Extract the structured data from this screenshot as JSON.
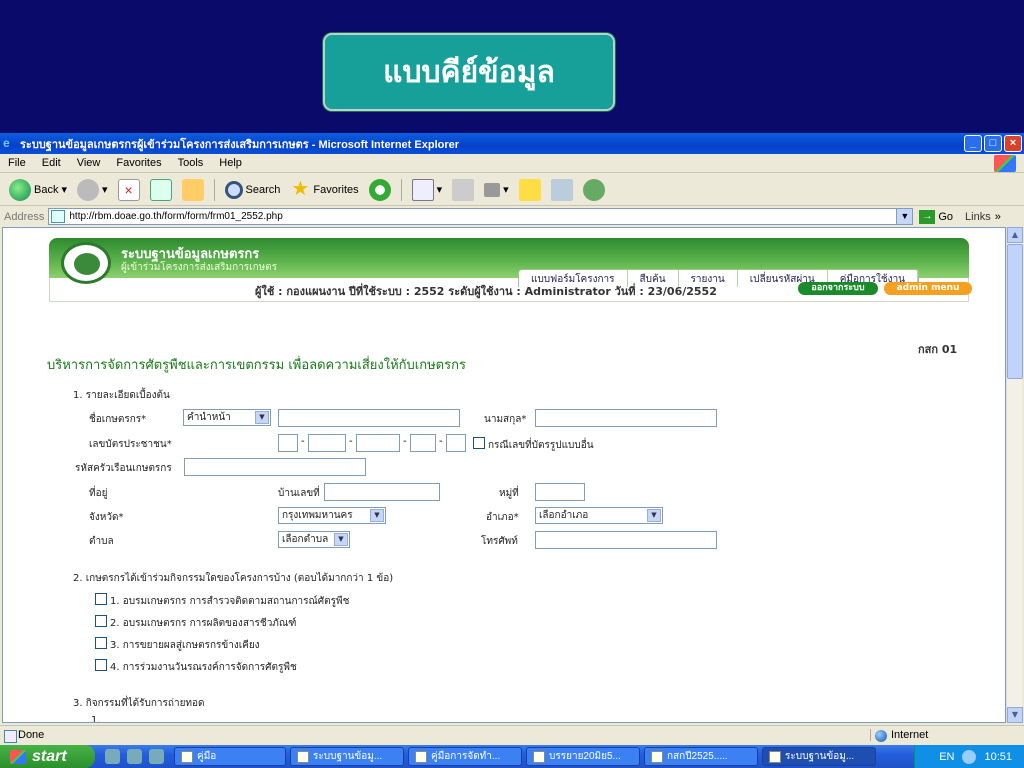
{
  "slide": {
    "banner_text": "แบบคีย์ข้อมูล"
  },
  "browser": {
    "title": "ระบบฐานข้อมูลเกษตรกรผู้เข้าร่วมโครงการส่งเสริมการเกษตร - Microsoft Internet Explorer",
    "menu": [
      "File",
      "Edit",
      "View",
      "Favorites",
      "Tools",
      "Help"
    ],
    "toolbar": {
      "back": "Back",
      "search": "Search",
      "favorites": "Favorites"
    },
    "address_label": "Address",
    "address": "http://rbm.doae.go.th/form/form/frm01_2552.php",
    "go": "Go",
    "links": "Links",
    "status": "Done",
    "zone": "Internet"
  },
  "site": {
    "title": "ระบบฐานข้อมูลเกษตรกร",
    "subtitle": "ผู้เข้าร่วมโครงการส่งเสริมการเกษตร",
    "nav": [
      "แบบฟอร์มโครงการ",
      "สืบค้น",
      "รายงาน",
      "เปลี่ยนรหัสผ่าน",
      "คู่มือการใช้งาน"
    ],
    "userline": "ผู้ใช้ : กองแผนงาน   ปีที่ใช้ระบบ : 2552   ระดับผู้ใช้งาน : Administrator   วันที่ : 23/06/2552",
    "logout": "ออกจากระบบ",
    "admin_menu": "admin menu"
  },
  "form": {
    "code": "กสก 01",
    "title": "บริหารการจัดการศัตรูพืชและการเขตกรรม เพื่อลดความเสี่ยงให้กับเกษตรกร",
    "section1": "1. รายละเอียดเบื้องต้น",
    "farmer_name_label": "ชื่อเกษตรกร*",
    "prefix_value": "คำนำหน้า",
    "surname_label": "นามสกุล*",
    "id_label": "เลขบัตรประชาชน*",
    "id_other_label": "กรณีเลขที่บัตรรูปแบบอื่น",
    "household_label": "รหัสครัวเรือนเกษตรกร",
    "address_label": "ที่อยู่",
    "house_no_label": "บ้านเลขที่",
    "moo_label": "หมู่ที่",
    "province_label": "จังหวัด*",
    "province_value": "กรุงเทพมหานคร",
    "district_label": "อำเภอ*",
    "district_value": "เลือกอำเภอ",
    "subdistrict_label": "ตำบล",
    "subdistrict_value": "เลือกตำบล",
    "phone_label": "โทรศัพท์",
    "section2": "2. เกษตรกรได้เข้าร่วมกิจกรรมใดของโครงการบ้าง (ตอบได้มากกว่า 1 ข้อ)",
    "activities": [
      "1. อบรมเกษตรกร การสำรวจติดตามสถานการณ์ศัตรูพืช",
      "2. อบรมเกษตรกร การผลิตของสารชีวภัณฑ์",
      "3. การขยายผลสู่เกษตรกรข้างเคียง",
      "4. การร่วมงานวันรณรงค์การจัดการศัตรูพืช"
    ],
    "section3": "3. กิจกรรมที่ได้รับการถ่ายทอด",
    "section3_item": "1."
  },
  "taskbar": {
    "start": "start",
    "tasks": [
      "คู่มือ",
      "ระบบฐานข้อมู...",
      "คู่มือการจัดทำ...",
      "บรรยาย20มิย5...",
      "กสกปี2525.....",
      "ระบบฐานข้อมู..."
    ],
    "lang": "EN",
    "clock": "10:51"
  }
}
